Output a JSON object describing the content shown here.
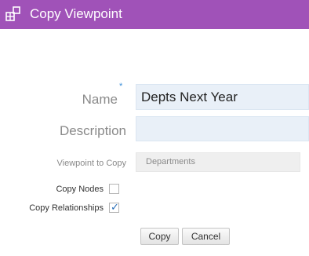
{
  "dialog": {
    "title": "Copy Viewpoint",
    "title_icon": "copy-viewpoint-icon",
    "accent_color": "#a052b8"
  },
  "form": {
    "name_label": "Name",
    "required_marker": "*",
    "name_value": "Depts Next Year",
    "description_label": "Description",
    "description_value": "",
    "viewpoint_to_copy_label": "Viewpoint to Copy",
    "viewpoint_to_copy_value": "Departments",
    "copy_nodes_label": "Copy Nodes",
    "copy_nodes_checked": false,
    "copy_relationships_label": "Copy Relationships",
    "copy_relationships_checked": true,
    "checkmark_glyph": "✓"
  },
  "buttons": {
    "copy_label": "Copy",
    "cancel_label": "Cancel"
  }
}
